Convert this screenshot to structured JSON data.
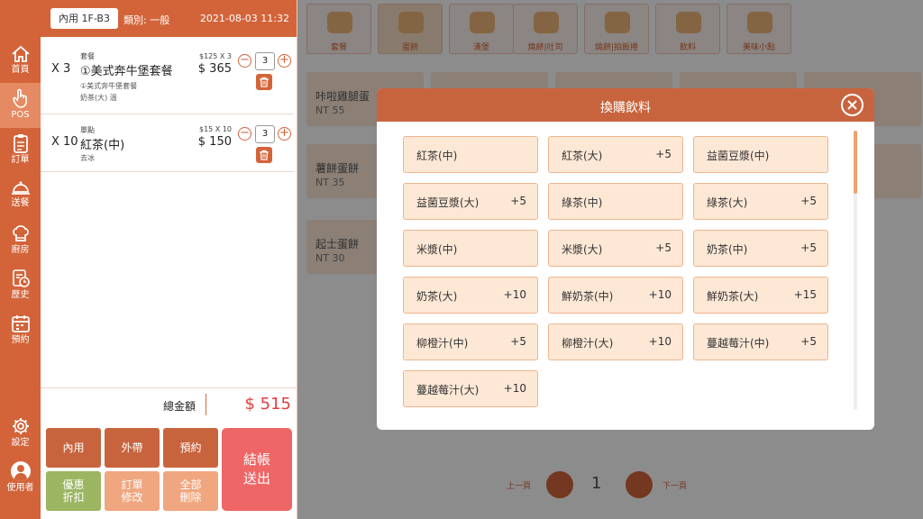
{
  "header": {
    "table": "內用 1F-B3",
    "category": "類別: 一般",
    "datetime": "2021-08-03 11:32"
  },
  "nav": {
    "home": "首頁",
    "pos": "POS",
    "orders": "訂單",
    "delivery": "送餐",
    "kitchen": "廚房",
    "history": "歷史",
    "reserve": "預約",
    "settings": "設定",
    "user": "使用者"
  },
  "order": {
    "lines": [
      {
        "qty": "X 3",
        "kind": "套餐",
        "name": "①美式奔牛堡套餐",
        "detail1": "①美式奔牛堡套餐",
        "detail2": "奶茶(大)  溫",
        "unit": "$125 X 3",
        "price": "$ 365",
        "count": "3"
      },
      {
        "qty": "X 10",
        "kind": "單點",
        "name": "紅茶(中)",
        "detail1": "去冰",
        "unit": "$15 X 10",
        "price": "$ 150",
        "count": "3"
      }
    ],
    "total_label": "總金額",
    "total_value": "$ 515"
  },
  "actions": {
    "dine_in": "內用",
    "takeout": "外帶",
    "reserve": "預約",
    "discount_1": "優惠",
    "discount_2": "折扣",
    "modify_1": "訂單",
    "modify_2": "修改",
    "delete_1": "全部",
    "delete_2": "刪除",
    "checkout_1": "結帳",
    "checkout_2": "送出"
  },
  "menu": {
    "categories": [
      "套餐",
      "蛋餅",
      "漢堡",
      "燒餅|吐司",
      "燒餅|拍飯捲",
      "飲料",
      "美味小點"
    ],
    "products": [
      {
        "name": "咔啦雞腿蛋",
        "price": "NT 55"
      },
      {
        "name": "薯餅蛋餅",
        "price": "NT 35"
      },
      {
        "name": "起士蛋餅",
        "price": "NT 30"
      }
    ],
    "prev": "上一頁",
    "next": "下一頁",
    "page": "1"
  },
  "modal": {
    "title": "換購飲料",
    "options": [
      {
        "name": "紅茶(中)",
        "extra": ""
      },
      {
        "name": "紅茶(大)",
        "extra": "+5"
      },
      {
        "name": "益菌豆漿(中)",
        "extra": ""
      },
      {
        "name": "益菌豆漿(大)",
        "extra": "+5"
      },
      {
        "name": "綠茶(中)",
        "extra": ""
      },
      {
        "name": "綠茶(大)",
        "extra": "+5"
      },
      {
        "name": "米漿(中)",
        "extra": ""
      },
      {
        "name": "米漿(大)",
        "extra": "+5"
      },
      {
        "name": "奶茶(中)",
        "extra": "+5"
      },
      {
        "name": "奶茶(大)",
        "extra": "+10"
      },
      {
        "name": "鮮奶茶(中)",
        "extra": "+10"
      },
      {
        "name": "鮮奶茶(大)",
        "extra": "+15"
      },
      {
        "name": "柳橙汁(中)",
        "extra": "+5"
      },
      {
        "name": "柳橙汁(大)",
        "extra": "+10"
      },
      {
        "name": "蔓越莓汁(中)",
        "extra": "+5"
      },
      {
        "name": "蔓越莓汁(大)",
        "extra": "+10"
      }
    ]
  },
  "colors": {
    "brand": "#d3643a",
    "modal_header": "#c8643d",
    "option_bg": "#fde8d6",
    "total": "#e23d3d",
    "discount_btn": "#9bb561",
    "light_btn": "#f0a67f",
    "checkout_btn": "#ee6666"
  }
}
